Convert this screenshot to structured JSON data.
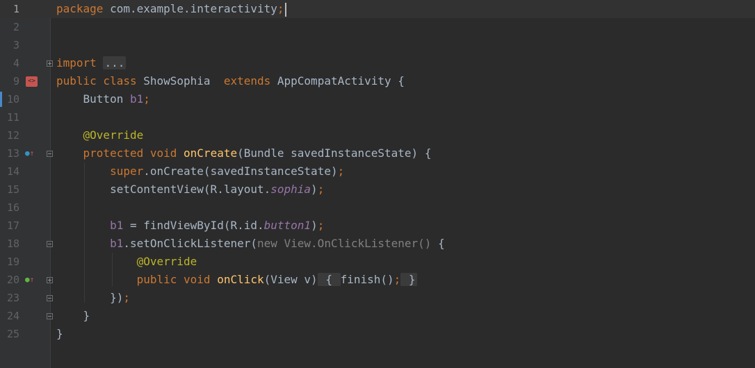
{
  "editor": {
    "lines": [
      {
        "num": "1",
        "tokens": [
          [
            "kw",
            "package "
          ],
          [
            "p",
            "com.example.interactivity"
          ],
          [
            "kw",
            ";"
          ]
        ],
        "current": true,
        "caret": true
      },
      {
        "num": "2",
        "tokens": []
      },
      {
        "num": "3",
        "tokens": []
      },
      {
        "num": "4",
        "tokens": [
          [
            "kw",
            "import "
          ],
          [
            "fold",
            "..."
          ]
        ],
        "fold": "plus"
      },
      {
        "num": "9",
        "tokens": [
          [
            "kw",
            "public class "
          ],
          [
            "p",
            "ShowSophia  "
          ],
          [
            "kw",
            "extends "
          ],
          [
            "p",
            "AppCompatActivity {"
          ]
        ],
        "icon": "activity-icon"
      },
      {
        "num": "10",
        "tokens": [
          [
            "p",
            "    Button "
          ],
          [
            "field",
            "b1"
          ],
          [
            "kw",
            ";"
          ]
        ]
      },
      {
        "num": "11",
        "tokens": []
      },
      {
        "num": "12",
        "tokens": [
          [
            "ann",
            "    @Override"
          ]
        ]
      },
      {
        "num": "13",
        "tokens": [
          [
            "kw",
            "    protected void "
          ],
          [
            "fn",
            "onCreate"
          ],
          [
            "p",
            "(Bundle savedInstanceState) {"
          ]
        ],
        "icon": "override-icon",
        "fold": "minus"
      },
      {
        "num": "14",
        "tokens": [
          [
            "kw",
            "        super"
          ],
          [
            "p",
            ".onCreate(savedInstanceState)"
          ],
          [
            "kw",
            ";"
          ]
        ]
      },
      {
        "num": "15",
        "tokens": [
          [
            "p",
            "        setContentView(R.layout."
          ],
          [
            "ital",
            "sophia"
          ],
          [
            "p",
            ")"
          ],
          [
            "kw",
            ";"
          ]
        ]
      },
      {
        "num": "16",
        "tokens": []
      },
      {
        "num": "17",
        "tokens": [
          [
            "field",
            "        b1"
          ],
          [
            "p",
            " = findViewById(R.id."
          ],
          [
            "ital",
            "button1"
          ],
          [
            "p",
            ")"
          ],
          [
            "kw",
            ";"
          ]
        ]
      },
      {
        "num": "18",
        "tokens": [
          [
            "field",
            "        b1"
          ],
          [
            "p",
            ".setOnClickListener("
          ],
          [
            "gray",
            "new View.OnClickListener() "
          ],
          [
            "p",
            "{"
          ]
        ],
        "fold": "minus"
      },
      {
        "num": "19",
        "tokens": [
          [
            "ann",
            "            @Override"
          ]
        ]
      },
      {
        "num": "20",
        "tokens": [
          [
            "kw",
            "            public void "
          ],
          [
            "fn",
            "onClick"
          ],
          [
            "p",
            "(View v)"
          ],
          [
            "fold",
            " { "
          ],
          [
            "p",
            "finish()"
          ],
          [
            "kw",
            ";"
          ],
          [
            "fold",
            " }"
          ]
        ],
        "icon": "override-icon",
        "fold": "plus"
      },
      {
        "num": "23",
        "tokens": [
          [
            "p",
            "        })"
          ],
          [
            "kw",
            ";"
          ]
        ],
        "fold": "end"
      },
      {
        "num": "24",
        "tokens": [
          [
            "p",
            "    }"
          ]
        ],
        "fold": "end"
      },
      {
        "num": "25",
        "tokens": [
          [
            "p",
            "}"
          ]
        ]
      }
    ]
  },
  "colors": {
    "background": "#2b2b2b",
    "keyword": "#cc7832",
    "function": "#ffc66d",
    "annotation": "#bbb529",
    "field": "#9876aa",
    "plain": "#a9b7c6"
  }
}
